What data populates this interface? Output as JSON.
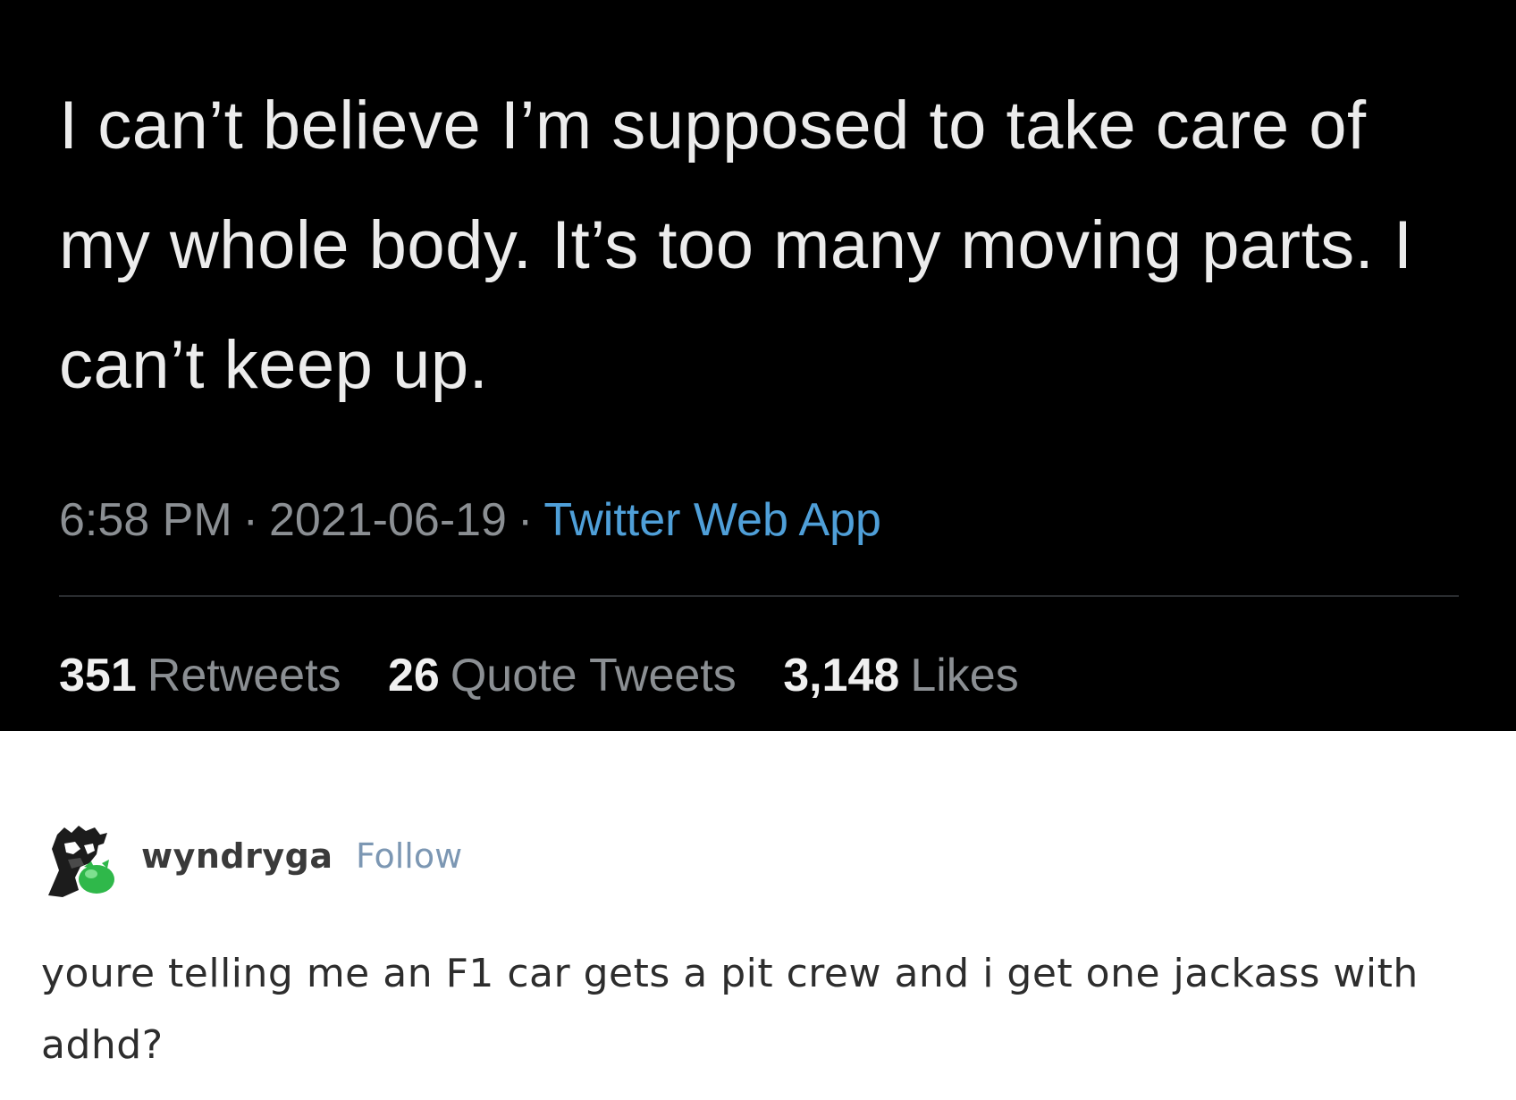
{
  "tweet": {
    "text": "I can’t believe I’m supposed to take care of my whole body. It’s too many moving parts. I can’t keep up.",
    "time": "6:58 PM",
    "date": "2021-06-19",
    "separator": "·",
    "source": "Twitter Web App",
    "stats": [
      {
        "count": "351",
        "label": "Retweets"
      },
      {
        "count": "26",
        "label": "Quote Tweets"
      },
      {
        "count": "3,148",
        "label": "Likes"
      }
    ]
  },
  "reply": {
    "username": "wyndryga",
    "follow_label": "Follow",
    "text": "youre telling me an F1 car gets a pit crew and i get one jackass with adhd?"
  },
  "colors": {
    "tweet_background": "#000000",
    "tweet_text": "#ececec",
    "meta_gray": "#8b8f93",
    "source_blue": "#4f9fd8",
    "follow_blue": "#7c97b3",
    "avatar_accent": "#2fb84a"
  },
  "icons": {
    "avatar": "avatar-character-icon"
  }
}
